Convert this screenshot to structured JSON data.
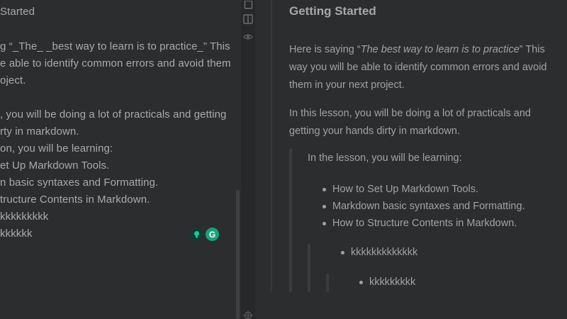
{
  "editor": {
    "lines": [
      "Started",
      "",
      "g  “_The_ _best way to learn is to practice_” This",
      "e able to identify common errors and avoid them",
      "oject.",
      "",
      ", you will be doing a lot of practicals and getting",
      "rty in markdown.",
      "on, you will be learning:",
      "et Up Markdown Tools.",
      "n basic syntaxes and Formatting.",
      "tructure Contents in Markdown.",
      "kkkkkkkkk",
      "kkkkkk"
    ],
    "grammarly_label": "G"
  },
  "preview": {
    "heading": "Getting Started",
    "para1_prefix": "Here is saying “",
    "para1_quote": "The best way to learn is to practice",
    "para1_suffix": "” This way you will be able to identify common errors and avoid them in your next project.",
    "para2": "In this lesson, you will be doing a lot of practicals and getting your hands dirty in markdown.",
    "blockquote_intro": "In the lesson, you will be learning:",
    "list_items": [
      "How to Set Up Markdown Tools.",
      "Markdown basic syntaxes and Formatting.",
      "How to Structure Contents in Markdown."
    ],
    "nested1": "kkkkkkkkkkkkk",
    "nested2": "kkkkkkkkk"
  },
  "toolbar": {
    "icons": [
      "file-icon",
      "split-view-icon",
      "preview-eye-icon",
      "target-icon"
    ]
  },
  "colors": {
    "background": "#2b2d2f",
    "toolbar": "#262829",
    "text": "#a0a2a4",
    "grammarly_green": "#15a37b"
  }
}
